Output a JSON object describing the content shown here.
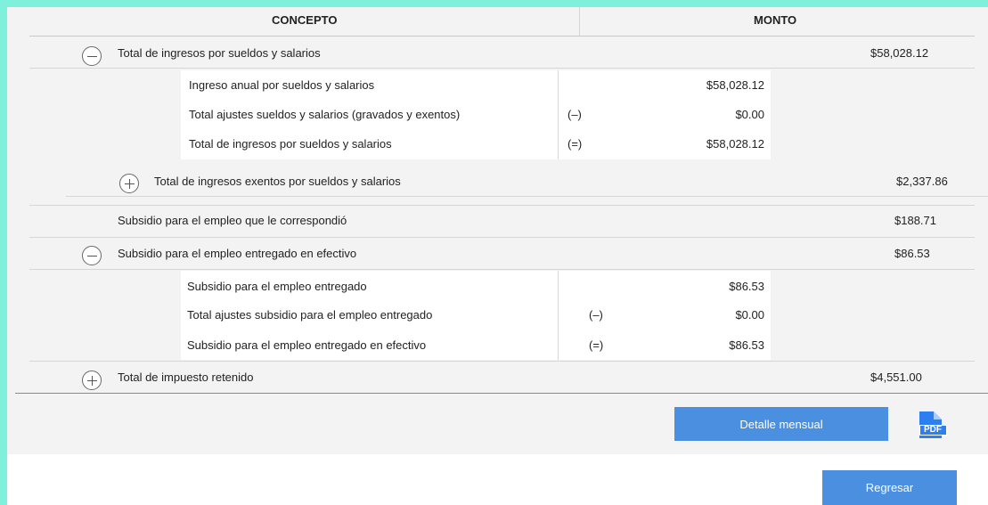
{
  "header": {
    "concept": "CONCEPTO",
    "amount": "MONTO"
  },
  "rows": {
    "ingresos": {
      "label": "Total de ingresos por sueldos y salarios",
      "value": "$58,028.12",
      "state": "expanded"
    },
    "ingresos_detail": [
      {
        "label": "Ingreso anual por sueldos y salarios",
        "op": "",
        "value": "$58,028.12"
      },
      {
        "label": "Total ajustes sueldos y salarios (gravados y exentos)",
        "op": "(–)",
        "value": "$0.00"
      },
      {
        "label": "Total de ingresos por sueldos y salarios",
        "op": "(=)",
        "value": "$58,028.12"
      }
    ],
    "exentos": {
      "label": "Total de ingresos exentos por sueldos y salarios",
      "value": "$2,337.86",
      "state": "collapsed"
    },
    "subsidio_correspondio": {
      "label": "Subsidio para el empleo que le correspondió",
      "value": "$188.71"
    },
    "subsidio_efectivo": {
      "label": "Subsidio para el empleo entregado en efectivo",
      "value": "$86.53",
      "state": "expanded"
    },
    "subsidio_detail": [
      {
        "label": "Subsidio para el empleo entregado",
        "op": "",
        "value": "$86.53"
      },
      {
        "label": "Total ajustes subsidio para el empleo entregado",
        "op": "(–)",
        "value": "$0.00"
      },
      {
        "label": "Subsidio para el empleo entregado en efectivo",
        "op": "(=)",
        "value": "$86.53"
      }
    ],
    "impuesto": {
      "label": "Total de impuesto retenido",
      "value": "$4,551.00",
      "state": "collapsed"
    }
  },
  "buttons": {
    "detalle": "Detalle mensual",
    "pdf_icon": "pdf-file-icon",
    "pdf_text": "PDF",
    "regresar": "Regresar"
  },
  "colors": {
    "accent": "#4a8fe0",
    "frame": "#7ef0dc",
    "panel": "#f3f3f3"
  }
}
